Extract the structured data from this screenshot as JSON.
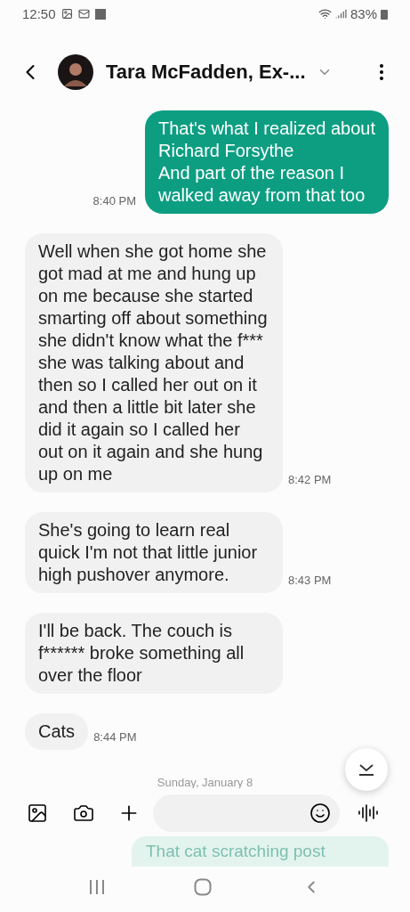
{
  "status_bar": {
    "time": "12:50",
    "battery": "83%"
  },
  "header": {
    "contact": "Tara McFadden, Ex-..."
  },
  "messages": [
    {
      "kind": "sent",
      "text": "That's what I realized about\nRichard Forsythe\nAnd part of the reason I\nwalked away from that too",
      "time": "8:40 PM"
    },
    {
      "kind": "received",
      "text": "Well when she got home she got mad at me and hung up on me because she started smarting off about something she didn't know what the f*** she was talking about and then so I called her out on it and then a little bit later she did it again so I called her out on it again and she hung up on me",
      "time": "8:42 PM"
    },
    {
      "kind": "received",
      "text": "She's going to learn real quick I'm not that little junior high pushover anymore.",
      "time": "8:43 PM"
    },
    {
      "kind": "received",
      "text": "I'll be back. The couch is f****** broke something all over the floor"
    },
    {
      "kind": "received",
      "text": "Cats",
      "time": "8:44 PM"
    }
  ],
  "date_separator": "Sunday, January 8",
  "ghost_message": "That cat scratching post"
}
